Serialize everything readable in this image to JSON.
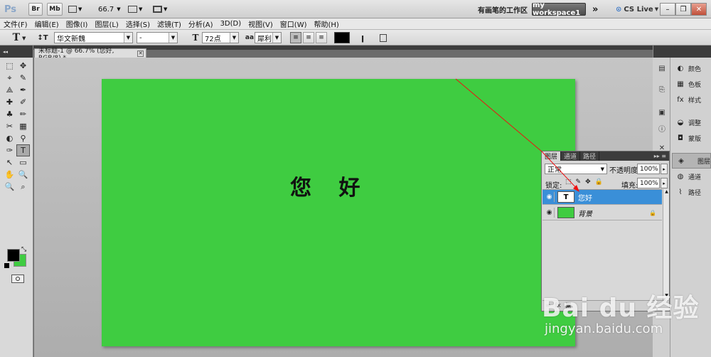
{
  "appbar": {
    "logo": "Ps",
    "btn_br": "Br",
    "btn_mb": "Mb",
    "zoom": "66.7",
    "workspace_label": "有画笔的工作区",
    "workspace_button": "my workspace1",
    "more": "»",
    "cs_live": "CS Live",
    "min": "–",
    "max": "❐",
    "close": "✕"
  },
  "menubar": {
    "items": [
      "文件(F)",
      "编辑(E)",
      "图像(I)",
      "图层(L)",
      "选择(S)",
      "滤镜(T)",
      "分析(A)",
      "3D(D)",
      "视图(V)",
      "窗口(W)",
      "帮助(H)"
    ]
  },
  "options": {
    "tool_glyph": "T",
    "font_family": "华文新魏",
    "font_style": "-",
    "font_size": "72点",
    "aa_label": "aa",
    "antialias": "犀利"
  },
  "document": {
    "tab_title": "未标题-1 @ 66.7% (您好, RGB/8) *",
    "canvas_color": "#3fcc41",
    "canvas_text": "您 好"
  },
  "tools": {
    "items": [
      "⬚",
      "✥",
      "⌖",
      "✎",
      "⟁",
      "✒",
      "✚",
      "✐",
      "♣",
      "✏",
      "✂",
      "▦",
      "◐",
      "⚲",
      "✑",
      "T",
      "↖",
      "▭",
      "✋",
      "🔍",
      "🔍",
      "⌕"
    ]
  },
  "colors": {
    "foreground": "#000000",
    "background": "#3fcc41",
    "accent": "#3a8fd8"
  },
  "dock": {
    "panels": [
      {
        "label": "颜色",
        "icon": "color-icon"
      },
      {
        "label": "色板",
        "icon": "swatches-icon"
      },
      {
        "label": "样式",
        "icon": "styles-icon"
      },
      {
        "label": "调整",
        "icon": "adjustments-icon"
      },
      {
        "label": "蒙版",
        "icon": "masks-icon"
      },
      {
        "label": "图层",
        "icon": "layers-icon"
      },
      {
        "label": "通道",
        "icon": "channels-icon"
      },
      {
        "label": "路径",
        "icon": "paths-icon"
      }
    ]
  },
  "layers_panel": {
    "tabs": [
      "图层",
      "通道",
      "路径"
    ],
    "blend_mode": "正常",
    "opacity_label": "不透明度:",
    "opacity": "100%",
    "lock_label": "锁定:",
    "fill_label": "填充:",
    "fill": "100%",
    "layers": [
      {
        "name": "您好",
        "thumb": "T",
        "selected": true
      },
      {
        "name": "背景",
        "thumb": "",
        "selected": false
      }
    ]
  },
  "watermark": {
    "brand": "Bai du 经验",
    "url": "jingyan.baidu.com"
  }
}
